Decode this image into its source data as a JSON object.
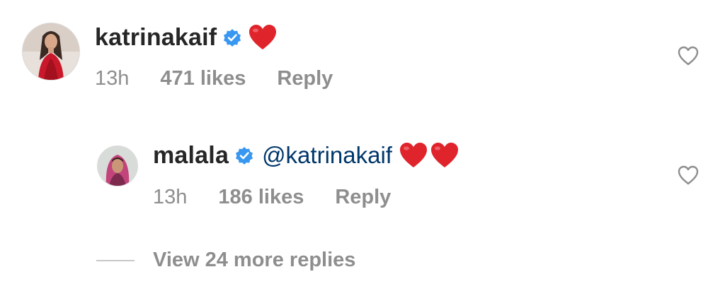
{
  "comments": [
    {
      "username": "katrinakaif",
      "verified": true,
      "mention": "",
      "emoji": [
        "❤️"
      ],
      "time": "13h",
      "likes": "471 likes",
      "reply_label": "Reply",
      "avatar_icon": "avatar-katrinakaif",
      "like_icon": "heart-outline-icon"
    },
    {
      "username": "malala",
      "verified": true,
      "mention": "@katrinakaif",
      "emoji": [
        "❤️",
        "❤️"
      ],
      "time": "13h",
      "likes": "186 likes",
      "reply_label": "Reply",
      "avatar_icon": "avatar-malala",
      "like_icon": "heart-outline-icon"
    }
  ],
  "view_more": {
    "label": "View 24 more replies"
  },
  "colors": {
    "text_primary": "#262626",
    "text_secondary": "#8e8e8e",
    "mention": "#00376b",
    "verified_blue": "#3897f0",
    "heart_red": "#e0242c"
  }
}
